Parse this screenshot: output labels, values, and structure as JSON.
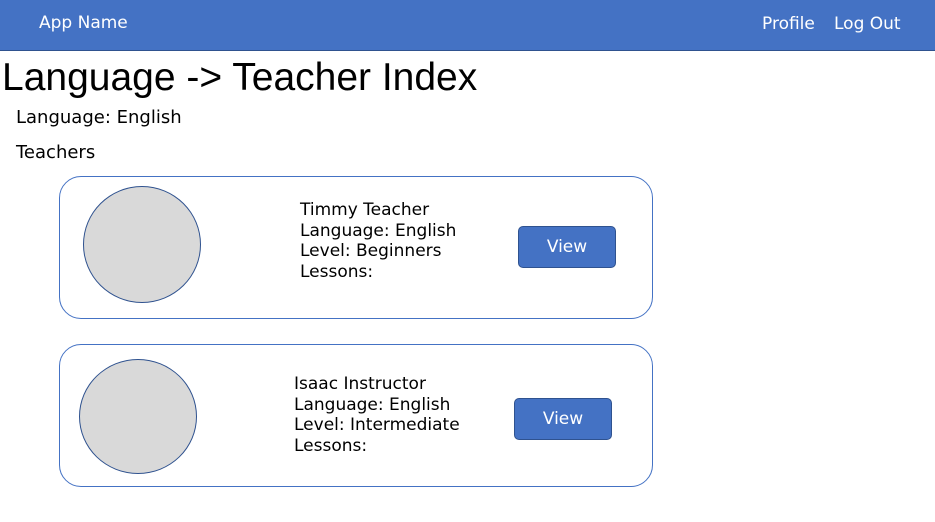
{
  "header": {
    "app_name": "App Name",
    "nav": {
      "profile": "Profile",
      "logout": "Log Out"
    },
    "background_color": "#4472c4"
  },
  "page": {
    "title": "Language -> Teacher Index",
    "language_line": "Language: English",
    "teachers_heading": "Teachers"
  },
  "teachers": [
    {
      "name": "Timmy Teacher",
      "language": "Language: English",
      "level": "Level: Beginners",
      "lessons": "Lessons:",
      "view_label": "View"
    },
    {
      "name": "Isaac Instructor",
      "language": "Language: English",
      "level": "Level: Intermediate",
      "lessons": "Lessons:",
      "view_label": "View"
    }
  ],
  "colors": {
    "accent": "#4472c4",
    "accent_border": "#2f528f",
    "avatar_fill": "#d9d9d9"
  }
}
